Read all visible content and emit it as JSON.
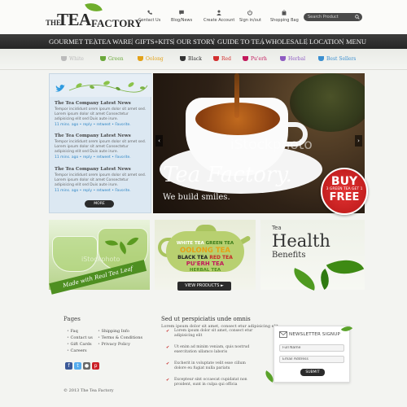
{
  "brand": {
    "logo_the": "THE",
    "logo_tea": "TEA",
    "logo_factory": "FACTORY"
  },
  "top_links": [
    {
      "label": "Contact Us",
      "icon": "phone-icon"
    },
    {
      "label": "Blog/News",
      "icon": "chat-icon"
    },
    {
      "label": "Create Account",
      "icon": "user-icon"
    },
    {
      "label": "Sign in/out",
      "icon": "power-icon"
    },
    {
      "label": "Shopping Bag",
      "icon": "bag-icon"
    }
  ],
  "search": {
    "placeholder": "Search Product"
  },
  "nav": [
    "GOURMET TEA",
    "TEA WARE",
    "GIFTS+KITS",
    "OUR STORY",
    "GUIDE TO TEA",
    "WHOLESALE",
    "LOCATION",
    "MENU"
  ],
  "tea_types": [
    {
      "label": "White",
      "color": "#bbbbbb"
    },
    {
      "label": "Green",
      "color": "#6aa83a"
    },
    {
      "label": "Oolong",
      "color": "#e2a21a"
    },
    {
      "label": "Black",
      "color": "#333333"
    },
    {
      "label": "Red",
      "color": "#d32f2f"
    },
    {
      "label": "Pu'erh",
      "color": "#c2185b"
    },
    {
      "label": "Herbal",
      "color": "#8e5bc2"
    },
    {
      "label": "Best Sellers",
      "color": "#3b8fd0"
    }
  ],
  "twitter": {
    "posts": [
      {
        "title": "The Tea Company Latest News",
        "text": "Tempor incididunt orem ipsum dolor sit amet sed. Lorem ipsum dolor sit amet Consectetur adipisicing elit sed Duis aute irure.",
        "meta": "11 mins. ago • reply • retweet • Favorite."
      },
      {
        "title": "The Tea Company Latest News",
        "text": "Tempor incididunt orem ipsum dolor sit amet sed. Lorem ipsum dolor sit amet Consectetur adipisicing elit sed Duis aute irure.",
        "meta": "11 mins. ago • reply • retweet • Favorite."
      },
      {
        "title": "The Tea Company Latest News",
        "text": "Tempor incididunt orem ipsum dolor sit amet sed. Lorem ipsum dolor sit amet Consectetur adipisicing elit sed Duis aute irure.",
        "meta": "11 mins. ago • reply • retweet • Favorite."
      }
    ],
    "more_label": "MORE"
  },
  "hero": {
    "watermark": "iStockphoto",
    "title": "Tea Factory.",
    "subtitle": "We build smiles.",
    "prev": "‹",
    "next": "›"
  },
  "badge": {
    "line1": "BUY",
    "line2": "3 GREEN TEA GET 1",
    "line3": "FREE"
  },
  "promo1": {
    "ribbon": "Made with Real Tea Leaf",
    "watermark": "iStockphoto"
  },
  "promo2": {
    "lines": [
      {
        "text": "WHITE TEA",
        "text2": "GREEN TEA",
        "color": "#ffffff",
        "color2": "#3a7a18"
      },
      {
        "text": "OOLONG TEA",
        "color": "#e6a117"
      },
      {
        "text": "BLACK TEA",
        "text2": "RED TEA",
        "color": "#222222",
        "color2": "#c62828"
      },
      {
        "text": "PU'ERH TEA",
        "color": "#c2185b"
      },
      {
        "text": "HERBAL TEA",
        "color": "#4a8c1c"
      }
    ],
    "button": "VIEW PRODUCTS ►"
  },
  "promo3": {
    "small": "Tea",
    "big": "Health",
    "sub": "Benefits"
  },
  "footer": {
    "pages_title": "Pages",
    "col1": [
      "Faq",
      "Contact us",
      "Gift Cards",
      "Careers"
    ],
    "col2": [
      "Shipping Info",
      "Terms & Conditions",
      "Privacy Policy"
    ],
    "social": [
      {
        "icon": "facebook-icon",
        "glyph": "f",
        "color": "#3b5998"
      },
      {
        "icon": "twitter-icon",
        "glyph": "t",
        "color": "#55acee"
      },
      {
        "icon": "flickr-icon",
        "glyph": "●",
        "color": "#6a6a6a"
      },
      {
        "icon": "pinterest-icon",
        "glyph": "p",
        "color": "#cb2027"
      }
    ],
    "copyright": "© 2013 The Tea Factory",
    "mid_title": "Sed ut perspiciatis unde omnis",
    "mid_sub": "Lorem ipsum dolor sit amet, consect etur adipisicing elit.",
    "checks": [
      "Lorem ipsum dolor sit amet, consect etur adipisicing elit",
      "Ut enim ad minim veniam, quis nostrud exercitation ullamco laboris",
      "Excherit in voluptate velit esse cillum dolore eu fugiat nulla pariatu",
      "Excepteur sint occaecat cupidatat non proident, sunt in culpa qui officia"
    ],
    "check_glyph": "✔",
    "newsletter": {
      "title": "NEWSLETTER SIGNUP",
      "name_placeholder": "Full Name",
      "email_placeholder": "Email Address",
      "submit": "SUBMIT"
    }
  }
}
